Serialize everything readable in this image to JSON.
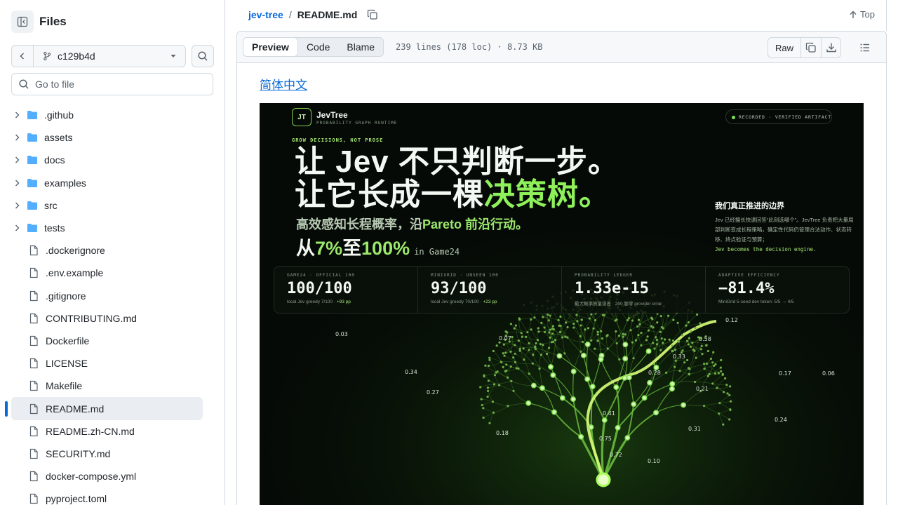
{
  "sidebar": {
    "title": "Files",
    "branch": "c129b4d",
    "goto_placeholder": "Go to file",
    "items": [
      {
        "name": ".github",
        "type": "folder"
      },
      {
        "name": "assets",
        "type": "folder"
      },
      {
        "name": "docs",
        "type": "folder"
      },
      {
        "name": "examples",
        "type": "folder"
      },
      {
        "name": "src",
        "type": "folder"
      },
      {
        "name": "tests",
        "type": "folder"
      },
      {
        "name": ".dockerignore",
        "type": "file"
      },
      {
        "name": ".env.example",
        "type": "file"
      },
      {
        "name": ".gitignore",
        "type": "file"
      },
      {
        "name": "CONTRIBUTING.md",
        "type": "file"
      },
      {
        "name": "Dockerfile",
        "type": "file"
      },
      {
        "name": "LICENSE",
        "type": "file"
      },
      {
        "name": "Makefile",
        "type": "file"
      },
      {
        "name": "README.md",
        "type": "file",
        "selected": true
      },
      {
        "name": "README.zh-CN.md",
        "type": "file"
      },
      {
        "name": "SECURITY.md",
        "type": "file"
      },
      {
        "name": "docker-compose.yml",
        "type": "file"
      },
      {
        "name": "pyproject.toml",
        "type": "file"
      }
    ]
  },
  "header": {
    "repo": "jev-tree",
    "separator": "/",
    "file": "README.md",
    "top_label": "Top"
  },
  "toolbar": {
    "tabs": [
      "Preview",
      "Code",
      "Blame"
    ],
    "active_tab": "Preview",
    "meta": "239 lines (178 loc) · 8.73 KB",
    "raw_label": "Raw"
  },
  "readme": {
    "lang_link": "简体中文"
  },
  "banner": {
    "logo": "JT",
    "name": "JevTree",
    "subtitle": "PROBABILITY GRAPH RUNTIME",
    "pill": "RECORDED · VERIFIED ARTIFACT",
    "tagline": "GROW DECISIONS, NOT PROSE",
    "headline_1": "让 Jev 不只判断一步。",
    "headline_2a": "让它长成一棵",
    "headline_2b": "决策树。",
    "sub_a": "高效感知长程概率，沿",
    "sub_b": "Pareto 前沿行动。",
    "big_a": "从",
    "big_b": "7%",
    "big_c": "至",
    "big_d": "100%",
    "big_suffix": "in Game24",
    "side_title": "我们真正推进的边界",
    "side_body": "Jev 已经擅长快速回答“此刻选哪个”。JevTree 负责把大量局部判断变成长程策略，确定性代码仍管理合法动作、状态转移、终点验证与预算；",
    "side_body_g": "Jev becomes the decision engine.",
    "stats": [
      {
        "label": "GAME24 · OFFICIAL 100",
        "value": "100/100",
        "note": "local Jev greedy 7/100 · ",
        "note_g": "+93 pp"
      },
      {
        "label": "MINIGRID · UNSEEN 100",
        "value": "93/100",
        "note": "local Jev greedy 70/100 · ",
        "note_g": "+23 pp"
      },
      {
        "label": "PROBABILITY LEDGER",
        "value": "1.33e-15",
        "note": "最大概率质量误差 · 200 题零 provider error",
        "note_g": ""
      },
      {
        "label": "ADAPTIVE  EFFICIENCY",
        "value": "−81.4%",
        "note": "MiniGrid 5-seed dev token: 5/5 → 4/5",
        "note_g": ""
      }
    ],
    "node_labels": [
      "0.12",
      "0.03",
      "0.07",
      "0.58",
      "0.33",
      "0.34",
      "0.28",
      "0.21",
      "0.17",
      "0.06",
      "0.27",
      "0.41",
      "0.31",
      "0.24",
      "0.18",
      "0.75",
      "0.72",
      "0.10"
    ]
  },
  "colors": {
    "accent": "#0969da",
    "banner_bg": "#050a06",
    "banner_green": "#8ef05a"
  }
}
